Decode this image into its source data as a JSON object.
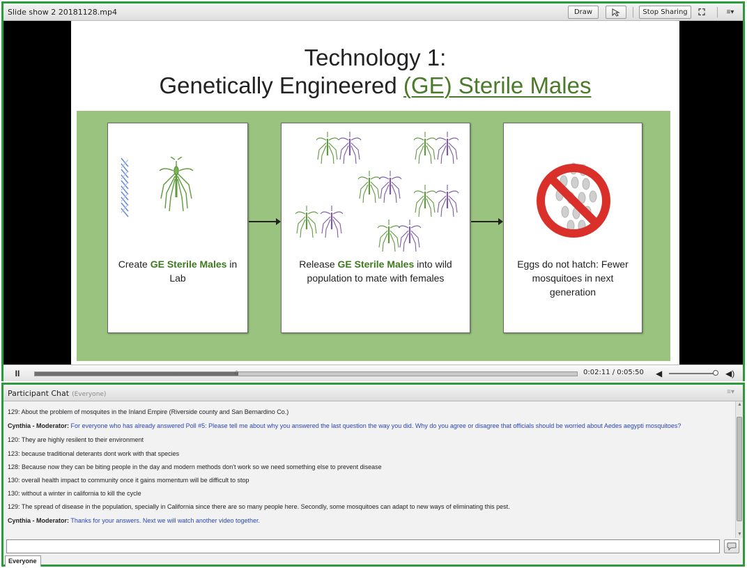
{
  "share": {
    "title": "Slide show 2 20181128.mp4",
    "draw_label": "Draw",
    "stop_label": "Stop Sharing",
    "fullscreen_glyph": "⛶",
    "menu_glyph": "≡▾"
  },
  "slide": {
    "title_line1": "Technology 1:",
    "title_line2_prefix": "Genetically Engineered ",
    "title_line2_highlight": "(GE) Sterile Males",
    "cards": [
      {
        "pre": "Create ",
        "hl": "GE Sterile Males",
        "post": " in Lab"
      },
      {
        "pre": "Release ",
        "hl": "GE Sterile Males",
        "post": " into wild population to mate with females"
      },
      {
        "text": "Eggs do not hatch: Fewer mosquitoes in next generation"
      }
    ],
    "colors": {
      "green_panel": "#99c37f",
      "title_green": "#4b7a2a",
      "male_mosquito": "#5f9a3c",
      "female_mosquito": "#7d5aa8",
      "no_sign": "#d9302a"
    }
  },
  "player": {
    "pause_glyph": "II",
    "time": "0:02:11 / 0:05:50",
    "progress_fraction": 0.374,
    "volume_fraction": 0.95
  },
  "chat": {
    "title": "Participant Chat",
    "scope": "(Everyone)",
    "send_to": "Everyone",
    "messages": [
      {
        "who": "129:",
        "text": "About the problem of mosquites in the Inland Empire (Riverside county and San Bernardino Co.)",
        "moderator": false
      },
      {
        "who": "Cynthia - Moderator:",
        "text": "For everyone who has already answered Poll #5: Please tell me about why you answered the last question the way you did. Why do you agree or disagree that officials should be worried about Aedes aegypti mosquitoes?",
        "moderator": true
      },
      {
        "who": "120:",
        "text": "They are highly resilent to their environment",
        "moderator": false
      },
      {
        "who": "123:",
        "text": "because traditional deterants dont work with that species",
        "moderator": false
      },
      {
        "who": "128:",
        "text": "Because now they can be biting people in the day and modern methods don't work so we need something else to prevent disease",
        "moderator": false
      },
      {
        "who": "130:",
        "text": "overall health impact to community once it gains momentum will be difficult to stop",
        "moderator": false
      },
      {
        "who": "130:",
        "text": "without a winter in california to kill the cycle",
        "moderator": false
      },
      {
        "who": "129:",
        "text": "The spread of disease in the population, specially in California since there are so many people here. Secondly, some mosquitoes can adapt to new ways of eliminating this pest.",
        "moderator": false
      },
      {
        "who": "Cynthia - Moderator:",
        "text": "Thanks for your answers. Next we will watch another video together.",
        "moderator": true
      }
    ]
  }
}
